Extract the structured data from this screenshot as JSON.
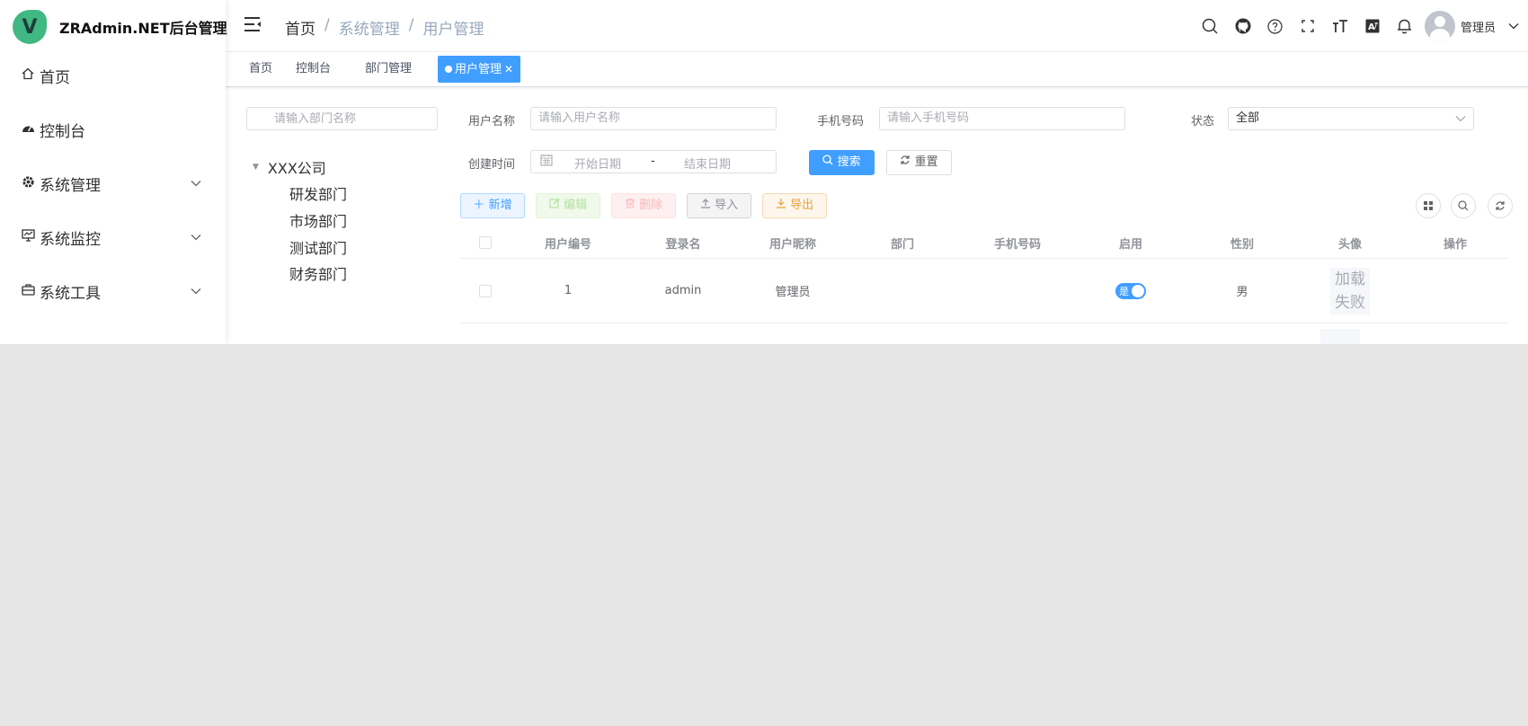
{
  "app": {
    "logo_letter": "V",
    "title": "ZRAdmin.NET后台管理"
  },
  "sidebar": {
    "items": [
      {
        "label": "首页",
        "icon": "home-icon",
        "has_children": false
      },
      {
        "label": "控制台",
        "icon": "dashboard-icon",
        "has_children": false
      },
      {
        "label": "系统管理",
        "icon": "settings-icon",
        "has_children": true
      },
      {
        "label": "系统监控",
        "icon": "monitor-icon",
        "has_children": true
      },
      {
        "label": "系统工具",
        "icon": "toolbox-icon",
        "has_children": true
      }
    ]
  },
  "navbar": {
    "breadcrumb": [
      "首页",
      "系统管理",
      "用户管理"
    ],
    "breadcrumb_sep": "/",
    "icons": [
      "search-icon",
      "github-icon",
      "help-icon",
      "fullscreen-icon",
      "font-size-icon",
      "language-icon",
      "bell-icon"
    ],
    "user_name": "管理员"
  },
  "tags": [
    {
      "label": "首页",
      "active": false
    },
    {
      "label": "控制台",
      "active": false
    },
    {
      "label": "部门管理",
      "active": false
    },
    {
      "label": "用户管理",
      "active": true
    }
  ],
  "dept_tree": {
    "search_placeholder": "请输入部门名称",
    "root": "XXX公司",
    "children": [
      "研发部门",
      "市场部门",
      "测试部门",
      "财务部门"
    ]
  },
  "search_form": {
    "username_label": "用户名称",
    "username_placeholder": "请输入用户名称",
    "phone_label": "手机号码",
    "phone_placeholder": "请输入手机号码",
    "status_label": "状态",
    "status_value": "全部",
    "created_label": "创建时间",
    "start_placeholder": "开始日期",
    "range_sep": "-",
    "end_placeholder": "结束日期",
    "search_button": "搜索",
    "reset_button": "重置"
  },
  "toolbar": {
    "add": "新增",
    "edit": "编辑",
    "delete": "删除",
    "import": "导入",
    "export": "导出"
  },
  "table": {
    "columns": [
      "用户编号",
      "登录名",
      "用户昵称",
      "部门",
      "手机号码",
      "启用",
      "性别",
      "头像",
      "操作"
    ],
    "rows": [
      {
        "id": "1",
        "login": "admin",
        "nickname": "管理员",
        "dept": "",
        "phone": "",
        "enabled": "是",
        "gender": "男",
        "avatar_fail": [
          "加载",
          "失败"
        ],
        "actions": ""
      }
    ]
  },
  "colors": {
    "primary": "#409eff",
    "logo_green": "#41b883",
    "background": "#e6e6e6"
  }
}
